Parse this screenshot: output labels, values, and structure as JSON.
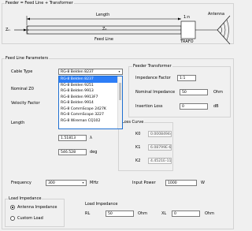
{
  "feeder_group": {
    "title": "Feeder = Feed Line + Transformer",
    "length_label": "Length",
    "ratio_label": "1:n",
    "antenna_label": "Antenna",
    "zin_label": "Zᵢₙ",
    "z0_label": "Z₀",
    "feedline_label": "Feed Line",
    "trafo_label": "TRAFO"
  },
  "feedline_params": {
    "title": "Feed Line Parameters",
    "cable_type_label": "Cable Type",
    "cable_type_value": "RG-8 Belden 8237",
    "cable_options": [
      "RG-8 Belden 8237",
      "RG-8 Belden 9251",
      "RG-8 Belden 9913",
      "RG-8 Belden 9913F7",
      "RG-8 Belden 9914",
      "RG-8 CommScope 2427K",
      "RG-8 CommScope 3227",
      "RG-8 Wireman CQ102"
    ],
    "nominal_z0_label": "Nominal Z0",
    "velocity_factor_label": "Velocity Factor",
    "length_label": "Length",
    "length_lambda_value": "1.51813",
    "length_lambda_unit": "λ",
    "length_deg_value": "546.528",
    "length_deg_unit": "deg",
    "loss_curve_label": "Loss Curve",
    "k0_label": "K0",
    "k0_value": "0.000849442",
    "k1_label": "K1",
    "k1_value": "6.08799E-6",
    "k2_label": "K2",
    "k2_value": "4.4521E-11"
  },
  "transformer": {
    "title": "Feeder Transformer",
    "impedance_factor_label": "Impedance Factor",
    "impedance_factor_value": "1:1",
    "nominal_impedance_label": "Nominal Impedance",
    "nominal_impedance_value": "50",
    "nominal_impedance_unit": "Ohm",
    "insertion_loss_label": "Insertion Loss",
    "insertion_loss_value": "0",
    "insertion_loss_unit": "dB"
  },
  "frequency": {
    "label": "Frequency",
    "value": "300",
    "unit": "MHz"
  },
  "input_power": {
    "label": "Input Power",
    "value": "1000",
    "unit": "W"
  },
  "load_impedance_group": {
    "title": "Load Impedance",
    "option_antenna": "Antenna Impedance",
    "option_custom": "Custom Load",
    "selected": "antenna"
  },
  "load_impedance_values": {
    "title": "Load Impedance",
    "rl_label": "RL",
    "rl_value": "50",
    "rl_unit": "Ohm",
    "xl_label": "XL",
    "xl_value": "0",
    "xl_unit": "Ohm"
  }
}
